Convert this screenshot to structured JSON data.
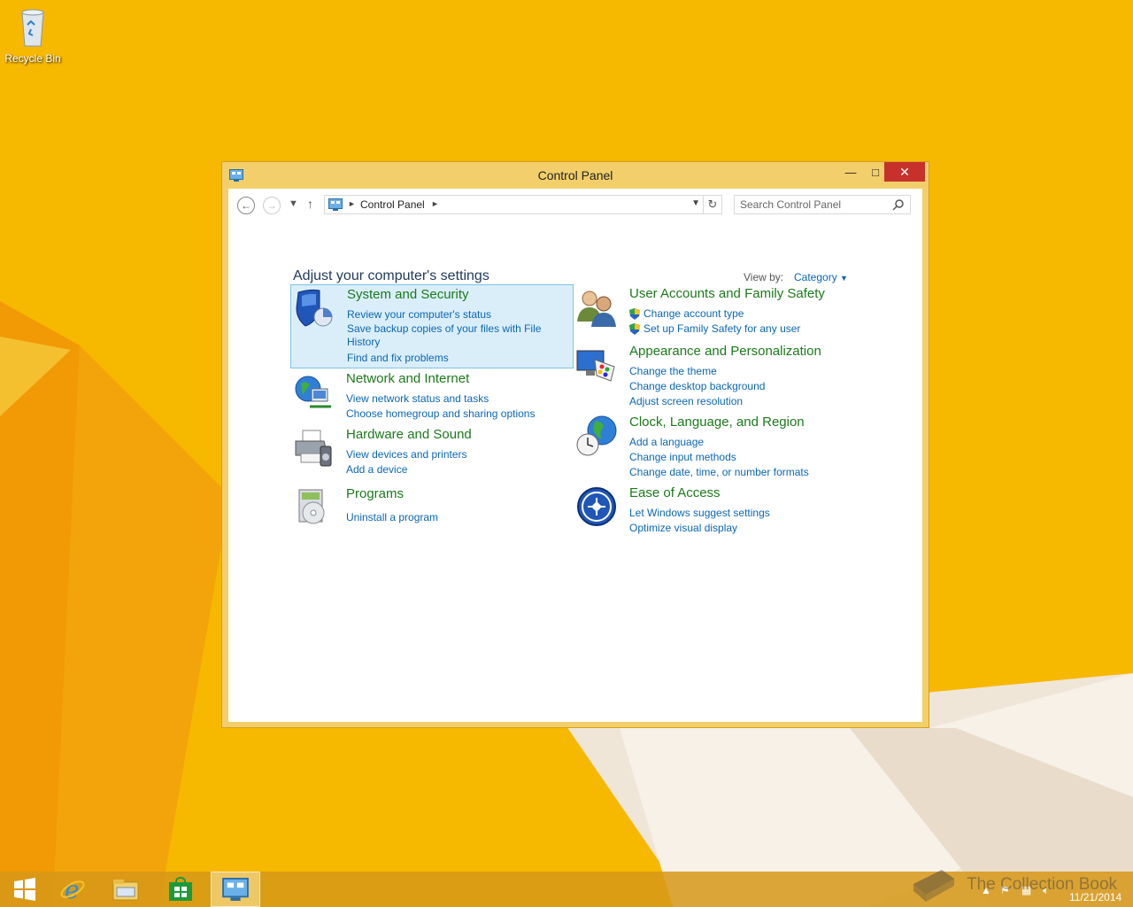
{
  "desktop": {
    "recycle_bin_label": "Recycle Bin"
  },
  "window": {
    "title": "Control Panel",
    "controls": {
      "minimize": "—",
      "maximize": "□",
      "close": "✕"
    }
  },
  "navbar": {
    "breadcrumb": "Control Panel",
    "search_placeholder": "Search Control Panel"
  },
  "content": {
    "heading": "Adjust your computer's settings",
    "view_by_label": "View by:",
    "view_by_value": "Category"
  },
  "categories": [
    {
      "title": "System and Security",
      "icon": "shield-icon",
      "links": [
        "Review your computer's status",
        "Save backup copies of your files with File History",
        "Find and fix problems"
      ]
    },
    {
      "title": "Network and Internet",
      "icon": "network-globe-icon",
      "links": [
        "View network status and tasks",
        "Choose homegroup and sharing options"
      ]
    },
    {
      "title": "Hardware and Sound",
      "icon": "printer-icon",
      "links": [
        "View devices and printers",
        "Add a device"
      ]
    },
    {
      "title": "Programs",
      "icon": "programs-disc-icon",
      "links": [
        "Uninstall a program"
      ]
    },
    {
      "title": "User Accounts and Family Safety",
      "icon": "users-icon",
      "links": [
        "Change account type",
        "Set up Family Safety for any user"
      ]
    },
    {
      "title": "Appearance and Personalization",
      "icon": "monitor-palette-icon",
      "links": [
        "Change the theme",
        "Change desktop background",
        "Adjust screen resolution"
      ]
    },
    {
      "title": "Clock, Language, and Region",
      "icon": "clock-globe-icon",
      "links": [
        "Add a language",
        "Change input methods",
        "Change date, time, or number formats"
      ]
    },
    {
      "title": "Ease of Access",
      "icon": "ease-of-access-icon",
      "links": [
        "Let Windows suggest settings",
        "Optimize visual display"
      ]
    }
  ],
  "taskbar": {
    "items": [
      "start-button",
      "internet-explorer",
      "file-explorer",
      "store",
      "control-panel"
    ],
    "date": "11/21/2014"
  },
  "watermark": "The Collection Book",
  "colors": {
    "accent_link": "#0a66b7",
    "category_title": "#1a7a1a",
    "close_button": "#c7312b",
    "desktop": "#f6b400"
  }
}
